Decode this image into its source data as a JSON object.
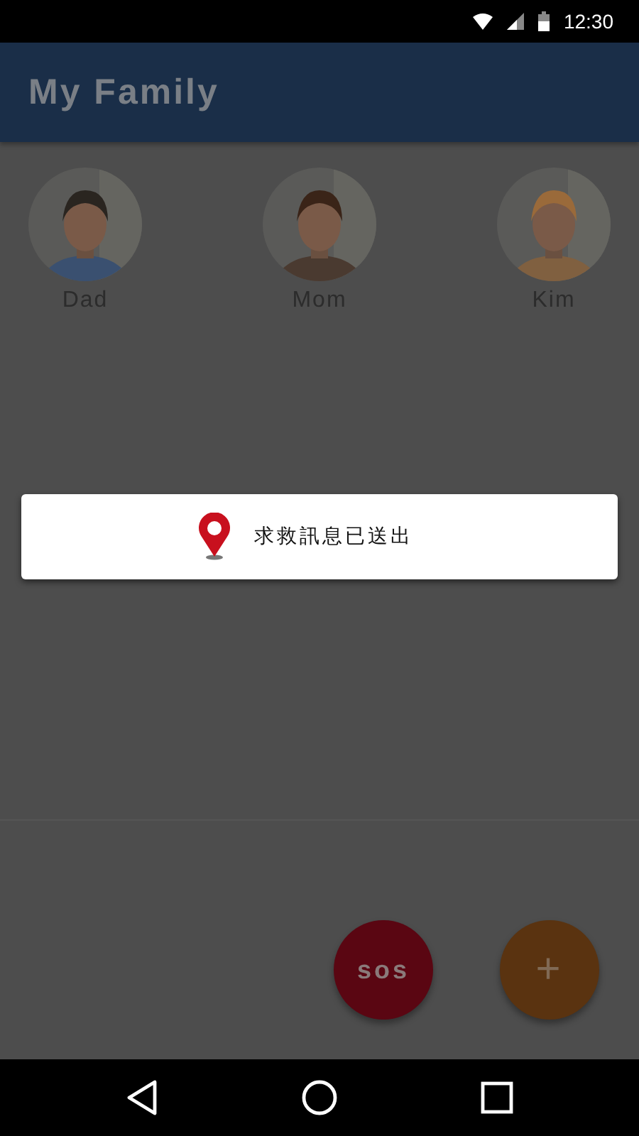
{
  "status_bar": {
    "time": "12:30"
  },
  "app_bar": {
    "title": "My Family"
  },
  "members": [
    {
      "name": "Dad",
      "kind": "picture"
    },
    {
      "name": "Mom",
      "kind": "picture"
    },
    {
      "name": "Kim",
      "kind": "picture"
    }
  ],
  "toast": {
    "message": "求救訊息已送出"
  },
  "actions": [
    {
      "kind": "sos",
      "label": "sos"
    },
    {
      "kind": "add",
      "label": "+"
    }
  ]
}
